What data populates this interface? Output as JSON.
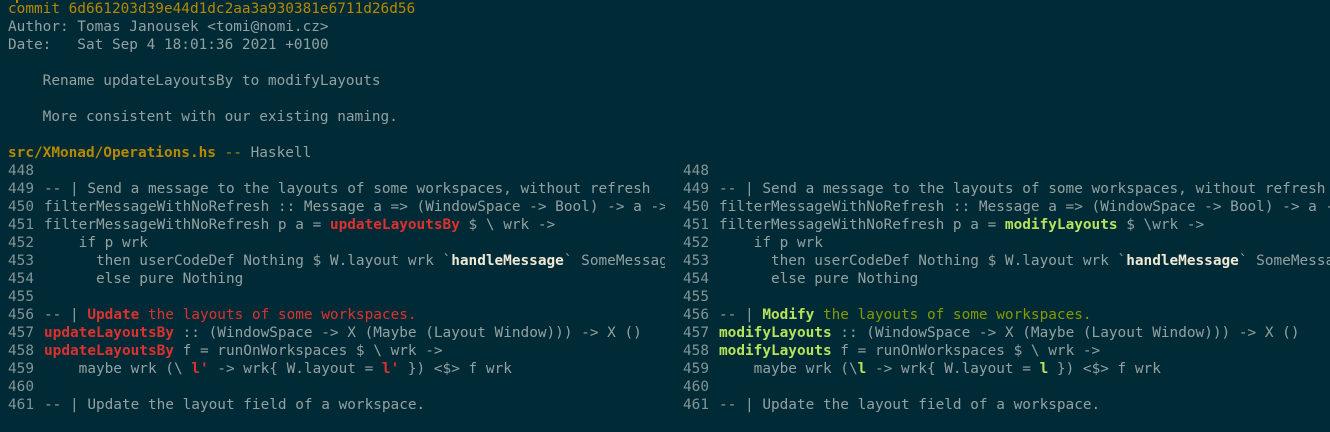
{
  "commit": {
    "hash_line": "commit 6d661203d39e44d1dc2aa3a930381e6711d26d56",
    "author_line": "Author: Tomas Janousek <tomi@nomi.cz>",
    "date_line": "Date:   Sat Sep 4 18:01:36 2021 +0100",
    "subject": "    Rename updateLayoutsBy to modifyLayouts",
    "body": "    More consistent with our existing naming."
  },
  "file": {
    "path": "src/XMonad/Operations.hs",
    "separator": " -- ",
    "language": "Haskell"
  },
  "left": [
    {
      "n": "448",
      "segs": []
    },
    {
      "n": "449",
      "segs": [
        {
          "t": "-- | Send a message to the layouts of some workspaces, without refresh",
          "c": ""
        }
      ]
    },
    {
      "n": "450",
      "segs": [
        {
          "t": "filterMessageWithNoRefresh :: Message a => (WindowSpace -> Bool) -> a -> X ()",
          "c": ""
        }
      ]
    },
    {
      "n": "451",
      "segs": [
        {
          "t": "filterMessageWithNoRefresh p a = ",
          "c": ""
        },
        {
          "t": "updateLayoutsBy",
          "c": "red-b"
        },
        {
          "t": " $ \\ wrk ->",
          "c": ""
        }
      ]
    },
    {
      "n": "452",
      "segs": [
        {
          "t": "    if p wrk",
          "c": ""
        }
      ]
    },
    {
      "n": "453",
      "segs": [
        {
          "t": "      then userCodeDef Nothing $ W.layout wrk `",
          "c": ""
        },
        {
          "t": "handleMessage",
          "c": "bold"
        },
        {
          "t": "` SomeMessage a",
          "c": ""
        }
      ]
    },
    {
      "n": "454",
      "segs": [
        {
          "t": "      else pure Nothing",
          "c": ""
        }
      ]
    },
    {
      "n": "455",
      "segs": []
    },
    {
      "n": "456",
      "segs": [
        {
          "t": "-- | ",
          "c": ""
        },
        {
          "t": "Update",
          "c": "red-b"
        },
        {
          "t": " the layouts of some workspaces.",
          "c": "red"
        }
      ]
    },
    {
      "n": "457",
      "segs": [
        {
          "t": "updateLayoutsBy",
          "c": "red-b"
        },
        {
          "t": " :: (WindowSpace -> X (Maybe (Layout Window))) -> X ()",
          "c": ""
        }
      ]
    },
    {
      "n": "458",
      "segs": [
        {
          "t": "updateLayoutsBy",
          "c": "red-b"
        },
        {
          "t": " f = runOnWorkspaces $ \\ wrk ->",
          "c": ""
        }
      ]
    },
    {
      "n": "459",
      "segs": [
        {
          "t": "    maybe wrk (\\ ",
          "c": ""
        },
        {
          "t": "l'",
          "c": "red-b"
        },
        {
          "t": " -> wrk{ W.layout = ",
          "c": ""
        },
        {
          "t": "l'",
          "c": "red-b"
        },
        {
          "t": " }) <$> f wrk",
          "c": ""
        }
      ]
    },
    {
      "n": "460",
      "segs": []
    },
    {
      "n": "461",
      "segs": [
        {
          "t": "-- | Update the layout field of a workspace.",
          "c": ""
        }
      ]
    }
  ],
  "right": [
    {
      "n": "448",
      "segs": []
    },
    {
      "n": "449",
      "segs": [
        {
          "t": "-- | Send a message to the layouts of some workspaces, without refresh",
          "c": ""
        }
      ]
    },
    {
      "n": "450",
      "segs": [
        {
          "t": "filterMessageWithNoRefresh :: Message a => (WindowSpace -> Bool) -> a -> X ()",
          "c": ""
        }
      ]
    },
    {
      "n": "451",
      "segs": [
        {
          "t": "filterMessageWithNoRefresh p a = ",
          "c": ""
        },
        {
          "t": "modifyLayouts",
          "c": "hl-green"
        },
        {
          "t": " $ \\wrk ->",
          "c": ""
        }
      ]
    },
    {
      "n": "452",
      "segs": [
        {
          "t": "    if p wrk",
          "c": ""
        }
      ]
    },
    {
      "n": "453",
      "segs": [
        {
          "t": "      then userCodeDef Nothing $ W.layout wrk `",
          "c": ""
        },
        {
          "t": "handleMessage",
          "c": "bold"
        },
        {
          "t": "` SomeMessage a",
          "c": ""
        }
      ]
    },
    {
      "n": "454",
      "segs": [
        {
          "t": "      else pure Nothing",
          "c": ""
        }
      ]
    },
    {
      "n": "455",
      "segs": []
    },
    {
      "n": "456",
      "segs": [
        {
          "t": "-- | ",
          "c": ""
        },
        {
          "t": "Modify",
          "c": "hl-green"
        },
        {
          "t": " the layouts of some workspaces.",
          "c": "green"
        }
      ]
    },
    {
      "n": "457",
      "segs": [
        {
          "t": "modifyLayouts",
          "c": "hl-green"
        },
        {
          "t": " :: (WindowSpace -> X (Maybe (Layout Window))) -> X ()",
          "c": ""
        }
      ]
    },
    {
      "n": "458",
      "segs": [
        {
          "t": "modifyLayouts",
          "c": "hl-green"
        },
        {
          "t": " f = runOnWorkspaces $ \\ wrk ->",
          "c": ""
        }
      ]
    },
    {
      "n": "459",
      "segs": [
        {
          "t": "    maybe wrk (\\",
          "c": ""
        },
        {
          "t": "l",
          "c": "hl-green"
        },
        {
          "t": " -> wrk{ W.layout = ",
          "c": ""
        },
        {
          "t": "l",
          "c": "hl-green"
        },
        {
          "t": " }) <$> f wrk",
          "c": ""
        }
      ]
    },
    {
      "n": "460",
      "segs": []
    },
    {
      "n": "461",
      "segs": [
        {
          "t": "-- | Update the layout field of a workspace.",
          "c": ""
        }
      ]
    }
  ],
  "colors": {
    "background": "#002b36",
    "foreground": "#93a1a1",
    "yellow": "#b58900",
    "removed": "#dc322f",
    "added": "#859900"
  }
}
